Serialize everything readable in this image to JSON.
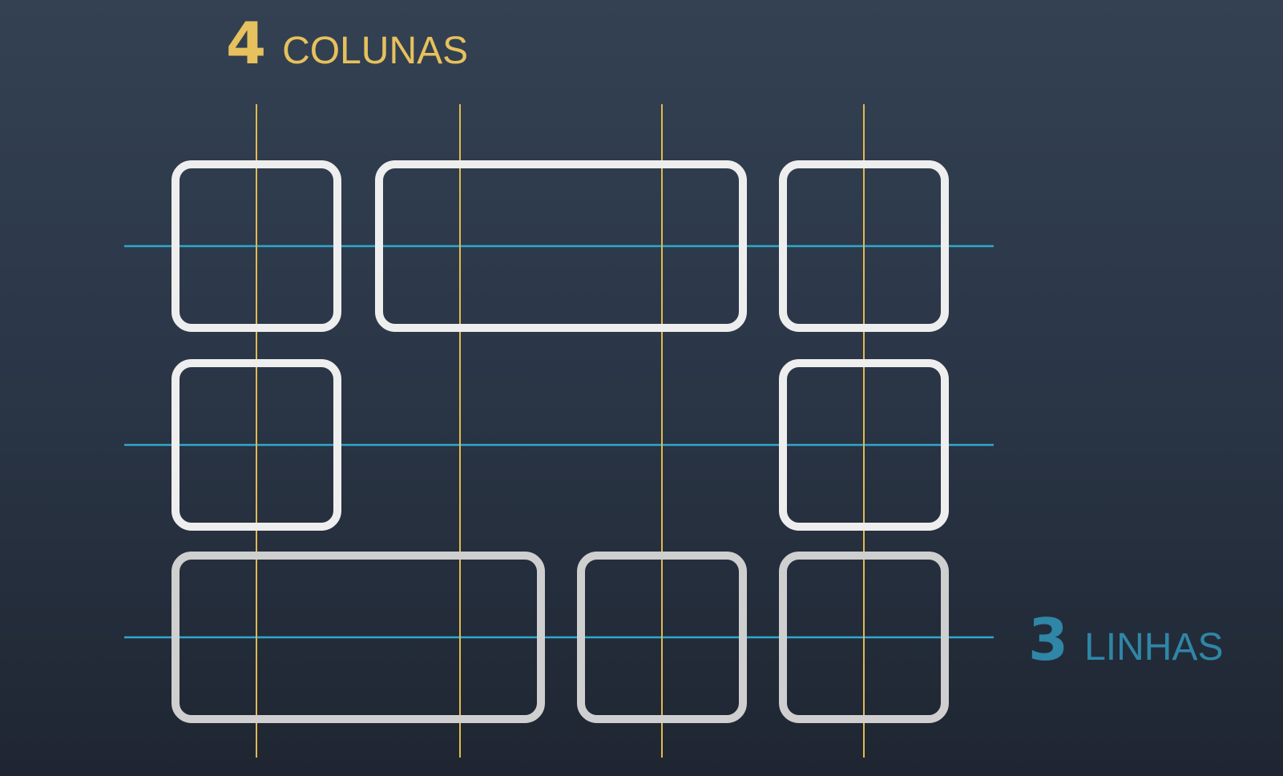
{
  "title_columns": {
    "number": "4",
    "word": "COLUNAS"
  },
  "title_rows": {
    "number": "3",
    "word": "LINHAS"
  },
  "colors": {
    "background_top": "#334152",
    "background_bottom": "#1f2632",
    "column_line": "#e2b94f",
    "row_line": "#2fa7cc",
    "cell_outline": "#eeeeee",
    "columns_label": "#e7c15d",
    "rows_label": "#2f86a6"
  },
  "grid": {
    "columns": 4,
    "rows": 3,
    "cells": [
      {
        "row": 1,
        "col": 1,
        "col_span": 1
      },
      {
        "row": 1,
        "col": 2,
        "col_span": 2
      },
      {
        "row": 1,
        "col": 4,
        "col_span": 1
      },
      {
        "row": 2,
        "col": 1,
        "col_span": 1
      },
      {
        "row": 2,
        "col": 4,
        "col_span": 1
      },
      {
        "row": 3,
        "col": 1,
        "col_span": 2
      },
      {
        "row": 3,
        "col": 3,
        "col_span": 1
      },
      {
        "row": 3,
        "col": 4,
        "col_span": 1
      }
    ]
  }
}
